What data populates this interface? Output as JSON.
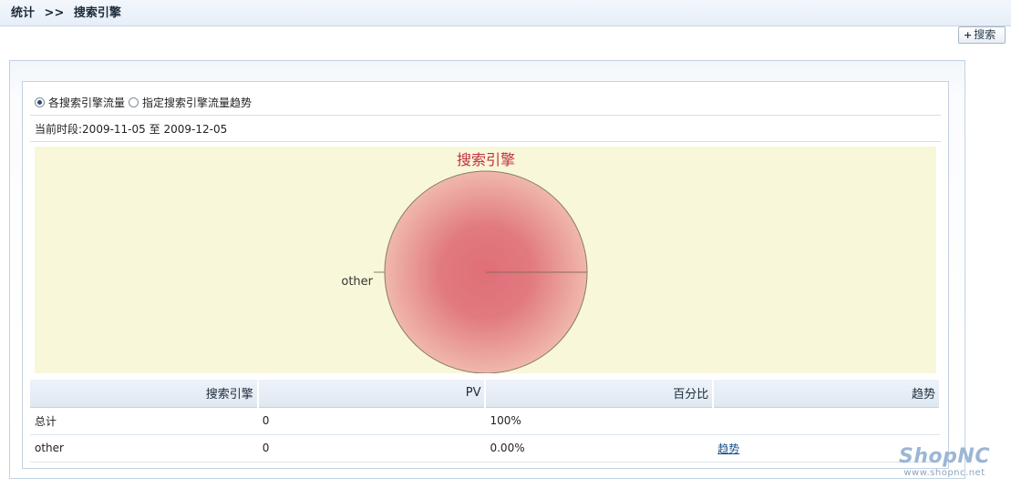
{
  "breadcrumb": {
    "parent": "统计",
    "separator": ">>",
    "current": "搜索引擎"
  },
  "toolbar": {
    "search_label": "搜索",
    "search_icon": "plus-icon"
  },
  "view_options": [
    {
      "label": "各搜索引擎流量",
      "checked": true
    },
    {
      "label": "指定搜索引擎流量趋势",
      "checked": false
    }
  ],
  "period": {
    "label": "当前时段:",
    "start": "2009-11-05",
    "to": "至",
    "end": "2009-12-05"
  },
  "chart_data": {
    "type": "pie",
    "title": "搜索引擎",
    "slices": [
      {
        "label": "other",
        "value": 0
      }
    ],
    "colors": {
      "pie_center": "#e06e78",
      "pie_edge": "#f0b8ac",
      "background": "#f8f7d9",
      "title": "#c03040"
    }
  },
  "table": {
    "columns": [
      "搜索引擎",
      "PV",
      "百分比",
      "趋势"
    ],
    "rows": [
      {
        "engine": "总计",
        "pv": "0",
        "percent": "100%",
        "trend": ""
      },
      {
        "engine": "other",
        "pv": "0",
        "percent": "0.00%",
        "trend": "趋势"
      }
    ]
  },
  "logo": {
    "name": "ShopNC",
    "url_text": "www.shopnc.net"
  }
}
